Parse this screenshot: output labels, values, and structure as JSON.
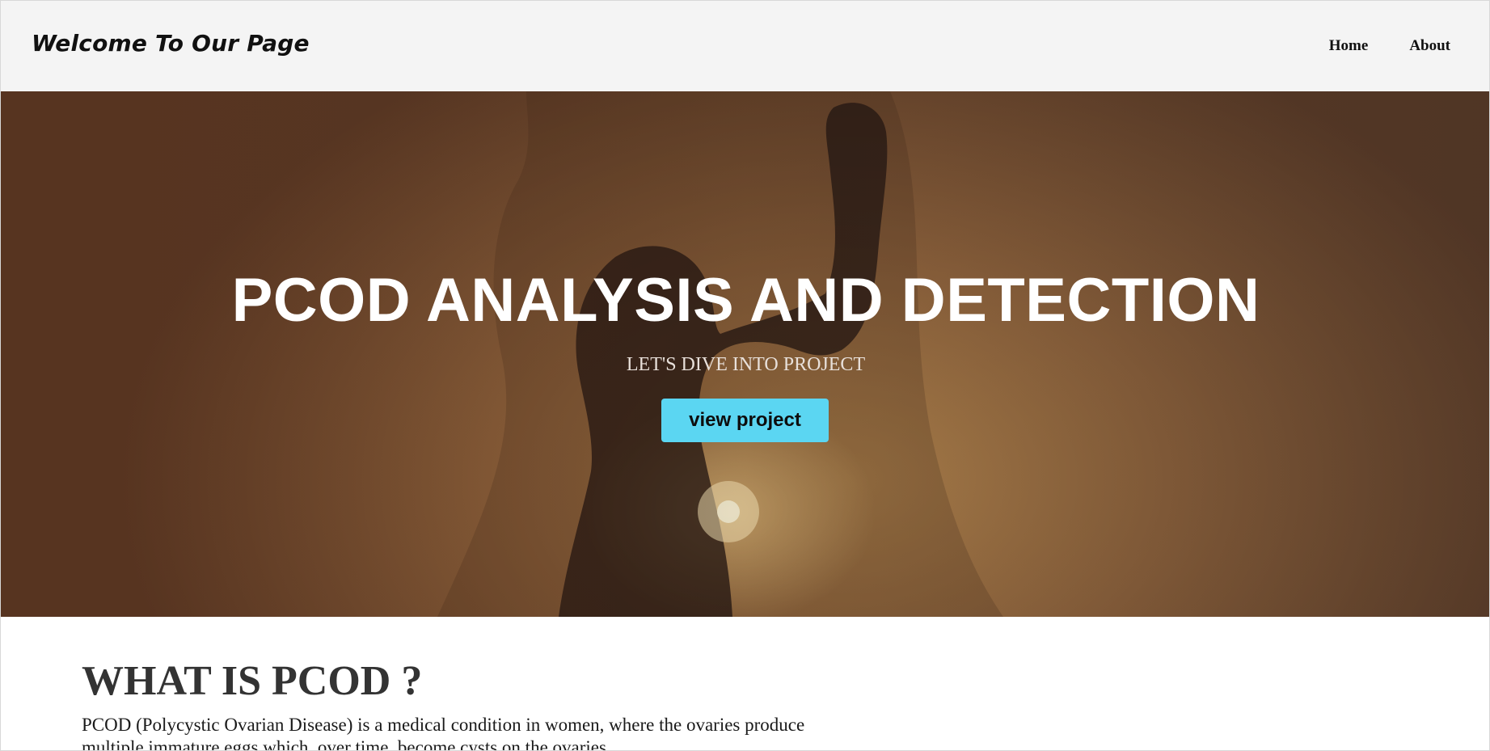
{
  "header": {
    "brand": "Welcome To Our Page",
    "nav": [
      {
        "label": "Home"
      },
      {
        "label": "About"
      }
    ]
  },
  "hero": {
    "title": "PCOD ANALYSIS AND DETECTION",
    "subtitle": "LET'S DIVE INTO PROJECT",
    "button_label": "view project",
    "button_color": "#5bd6f2"
  },
  "about": {
    "title": "WHAT IS PCOD ?",
    "body": "PCOD (Polycystic Ovarian Disease) is a medical condition in women, where the ovaries produce multiple immature eggs which, over time, become cysts on the ovaries."
  },
  "colors": {
    "header_bg": "#f4f4f4",
    "hero_tone": "#93663e",
    "heading_text": "#333333"
  }
}
